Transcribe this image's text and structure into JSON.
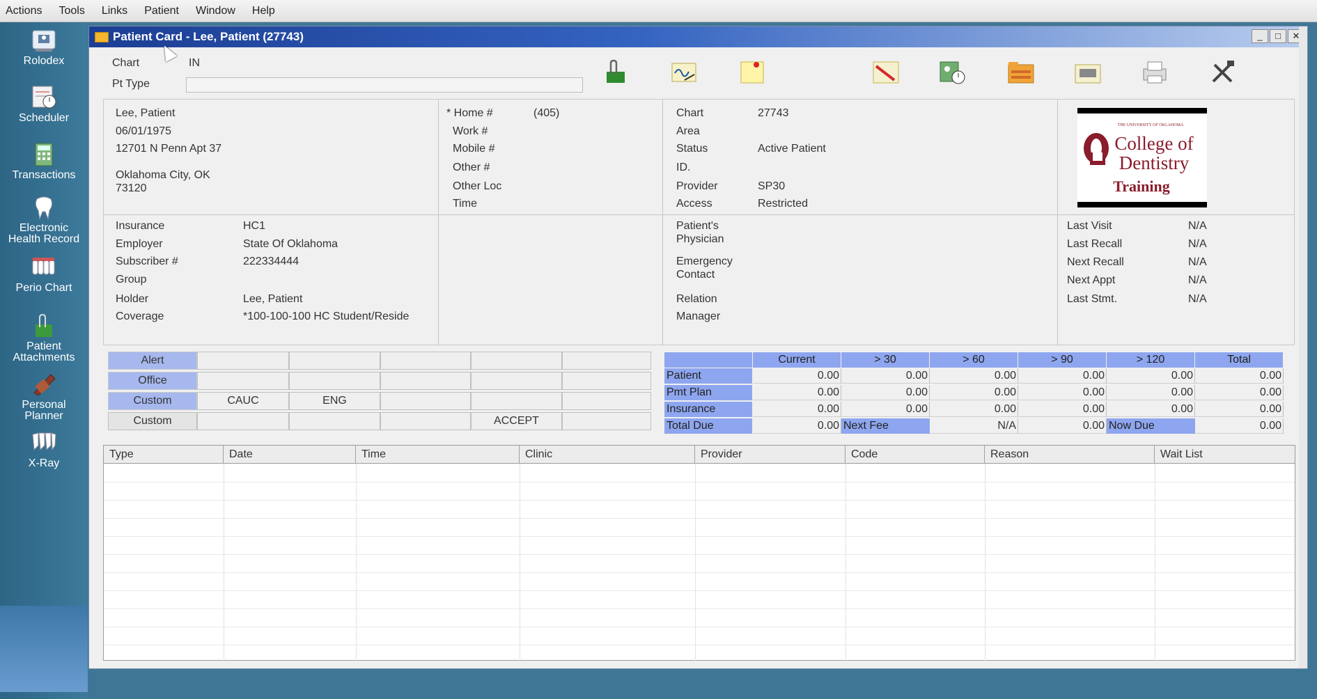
{
  "menu": [
    "Actions",
    "Tools",
    "Links",
    "Patient",
    "Window",
    "Help"
  ],
  "sidebar": [
    {
      "label": "Rolodex",
      "icon": "rolodex-icon"
    },
    {
      "label": "Scheduler",
      "icon": "scheduler-icon"
    },
    {
      "label": "Transactions",
      "icon": "calculator-icon"
    },
    {
      "label1": "Electronic",
      "label2": "Health Record",
      "icon": "tooth-icon"
    },
    {
      "label": "Perio Chart",
      "icon": "perio-chart-icon"
    },
    {
      "label1": "Patient",
      "label2": "Attachments",
      "icon": "attachments-icon"
    },
    {
      "label1": "Personal",
      "label2": "Planner",
      "icon": "planner-icon"
    },
    {
      "label": "X-Ray",
      "icon": "xray-icon"
    }
  ],
  "window": {
    "title": "Patient Card - Lee, Patient (27743)",
    "min": "_",
    "max": "□",
    "close": "✕"
  },
  "header": {
    "chart_label": "Chart",
    "chart_value": "IN",
    "pt_type_label": "Pt Type",
    "pt_type_value": ""
  },
  "patient": {
    "name": "Lee, Patient",
    "dob": "06/01/1975",
    "address1": "12701 N Penn Apt 37",
    "city": "Oklahoma City, OK",
    "zip": "73120"
  },
  "phones": {
    "home_label": "* Home #",
    "home_value": "(405)",
    "work_label": "Work #",
    "mobile_label": "Mobile #",
    "other_label": "Other #",
    "other_loc_label": "Other Loc",
    "time_label": "Time"
  },
  "account": {
    "chart_label": "Chart",
    "chart_value": "27743",
    "area_label": "Area",
    "area_value": "",
    "status_label": "Status",
    "status_value": "Active Patient",
    "id_label": "ID.",
    "id_value": "",
    "provider_label": "Provider",
    "provider_value": "SP30",
    "access_label": "Access",
    "access_value": "Restricted"
  },
  "logo": {
    "small": "THE UNIVERSITY OF OKLAHOMA",
    "line1": "College of",
    "line2": "Dentistry",
    "line3": "Training"
  },
  "insurance": {
    "insurance_label": "Insurance",
    "insurance_value": "HC1",
    "employer_label": "Employer",
    "employer_value": "State Of Oklahoma",
    "subscriber_label": "Subscriber #",
    "subscriber_value": "222334444",
    "group_label": "Group",
    "group_value": "",
    "holder_label": "Holder",
    "holder_value": "Lee, Patient",
    "coverage_label": "Coverage",
    "coverage_value": "*100-100-100 HC Student/Reside"
  },
  "contacts": {
    "physician_label1": "Patient's",
    "physician_label2": "Physician",
    "emergency_label1": "Emergency",
    "emergency_label2": "Contact",
    "relation_label": "Relation",
    "manager_label": "Manager"
  },
  "visits": {
    "last_visit_label": "Last Visit",
    "last_visit_value": "N/A",
    "last_recall_label": "Last Recall",
    "last_recall_value": "N/A",
    "next_recall_label": "Next Recall",
    "next_recall_value": "N/A",
    "next_appt_label": "Next Appt",
    "next_appt_value": "N/A",
    "last_stmt_label": "Last Stmt.",
    "last_stmt_value": "N/A"
  },
  "flags": {
    "rows": [
      {
        "label": "Alert",
        "cells": [
          "",
          "",
          "",
          "",
          ""
        ]
      },
      {
        "label": "Office",
        "cells": [
          "",
          "",
          "",
          "",
          ""
        ]
      },
      {
        "label": "Custom",
        "cells": [
          "CAUC",
          "ENG",
          "",
          "",
          ""
        ]
      },
      {
        "label": "Custom",
        "cells": [
          "",
          "",
          "",
          "ACCEPT",
          ""
        ]
      }
    ]
  },
  "aging": {
    "headers": [
      "",
      "Current",
      "> 30",
      "> 60",
      "> 90",
      "> 120",
      "Total"
    ],
    "rows": [
      {
        "label": "Patient",
        "values": [
          "0.00",
          "0.00",
          "0.00",
          "0.00",
          "0.00",
          "0.00"
        ]
      },
      {
        "label": "Pmt Plan",
        "values": [
          "0.00",
          "0.00",
          "0.00",
          "0.00",
          "0.00",
          "0.00"
        ]
      },
      {
        "label": "Insurance",
        "values": [
          "0.00",
          "0.00",
          "0.00",
          "0.00",
          "0.00",
          "0.00"
        ]
      }
    ],
    "total_due_label": "Total Due",
    "total_due_value": "0.00",
    "next_fee_label": "Next Fee",
    "next_fee_value": "N/A",
    "mid_value": "0.00",
    "now_due_label": "Now Due",
    "now_due_value": "0.00"
  },
  "appointments": {
    "columns": [
      "Type",
      "Date",
      "Time",
      "Clinic",
      "Provider",
      "Code",
      "Reason",
      "Wait List"
    ]
  },
  "colors": {
    "title_gradient_start": "#1c3e94",
    "grid_header": "#8ea6ef",
    "sidebar": "#2d6585",
    "logo_red": "#8a1c2b"
  }
}
